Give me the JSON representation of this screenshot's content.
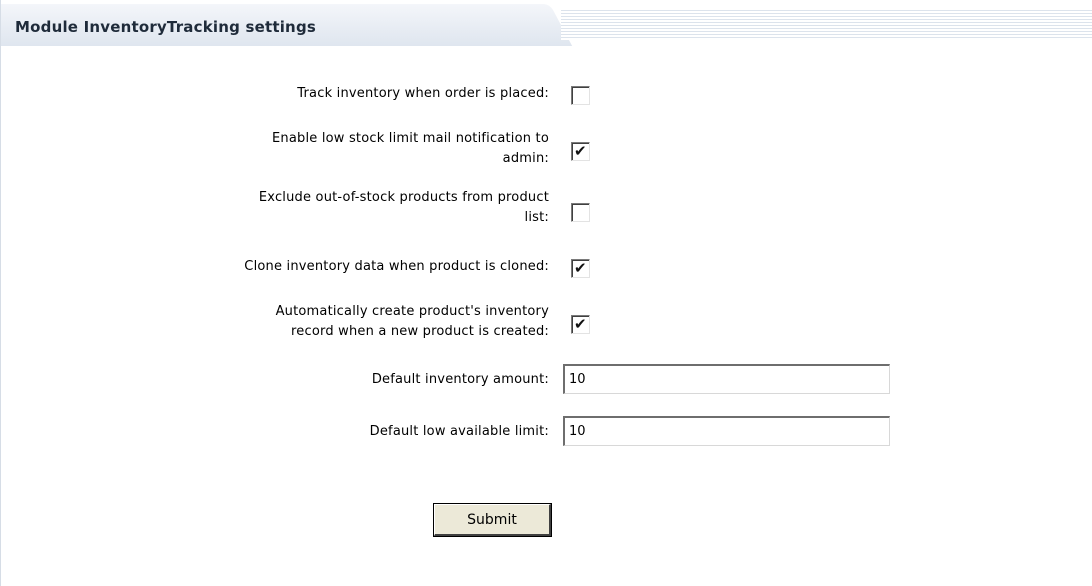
{
  "header": {
    "title": "Module InventoryTracking settings"
  },
  "settings": [
    {
      "label": "Track inventory when order is placed:",
      "checked": false
    },
    {
      "label": "Enable low stock limit mail notification to\nadmin:",
      "checked": true
    },
    {
      "label": "Exclude out-of-stock products from product\nlist:",
      "checked": false
    },
    {
      "label": "Clone inventory data when product is cloned:",
      "checked": true
    },
    {
      "label": "Automatically create product's inventory\nrecord when a new product is created:",
      "checked": true
    }
  ],
  "inputs": {
    "default_inventory_amount": {
      "label": "Default inventory amount:",
      "value": "10"
    },
    "default_low_available_limit": {
      "label": "Default low available limit:",
      "value": "10"
    }
  },
  "submit_label": "Submit",
  "check_glyph": "✔"
}
